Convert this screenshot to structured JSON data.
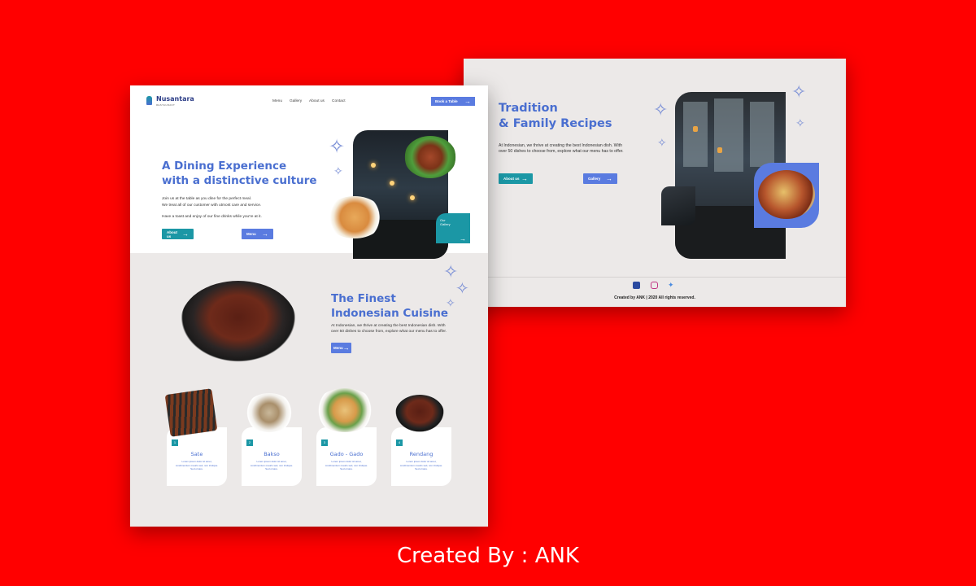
{
  "page2": {
    "title_line1": "Tradition",
    "title_line2": "& Family Recipes",
    "description": "At Indonesian, we thrive at creating the best Indonesian dish. With over 50 dishes to choose from, explore what our menu has to offer.",
    "about_button": "About us",
    "gallery_button": "Gallery",
    "social_icons": [
      "facebook-icon",
      "instagram-icon",
      "twitter-icon"
    ],
    "copyright": "Created by ANK | 2020 All rights reserved."
  },
  "page1": {
    "brand": "Nusantara",
    "brand_sub": "RESTAURANT",
    "nav": [
      "Menu",
      "Gallery",
      "About us",
      "Contact"
    ],
    "book_button": "Book a Table",
    "hero_title_line1": "A Dining Experience",
    "hero_title_line2": "with a distinctive culture",
    "hero_para1_line1": "Join us at the table as you dine for the perfect meal.",
    "hero_para1_line2": "We treat all of our customer with utmost care and service.",
    "hero_para2": "Have a toast and enjoy of our fine drinks while you're at it.",
    "about_button": "About us",
    "menu_button": "Menu",
    "gallery_card_line1": "Our",
    "gallery_card_line2": "Gallery",
    "section2_title_line1": "The Finest",
    "section2_title_line2": "Indonesian Cuisine",
    "section2_desc": "At Indonesian, we thrive at creating the best Indonesian dish. With over 50 dishes to choose from, explore what our menu has to offer.",
    "section2_button": "Menu",
    "dishes": [
      {
        "num": "1",
        "name": "Sate",
        "desc": "Lorem ipsum dolor sit amet, condimentum mauris sed, non tristique. Sed ornare."
      },
      {
        "num": "2",
        "name": "Bakso",
        "desc": "Lorem ipsum dolor sit amet, condimentum mauris sed, non tristique. Sed ornare."
      },
      {
        "num": "3",
        "name": "Gado - Gado",
        "desc": "Lorem ipsum dolor sit amet, condimentum mauris sed, non tristique. Sed ornare."
      },
      {
        "num": "4",
        "name": "Rendang",
        "desc": "Lorem ipsum dolor sit amet, condimentum mauris sed, non tristique. Sed ornare."
      }
    ]
  },
  "credit": "Created By : ANK",
  "colors": {
    "background": "#ff0000",
    "accent_blue": "#4a6fd0",
    "button_blue": "#5a7be0",
    "teal": "#1b97a5",
    "section_grey": "#ece9e8"
  }
}
